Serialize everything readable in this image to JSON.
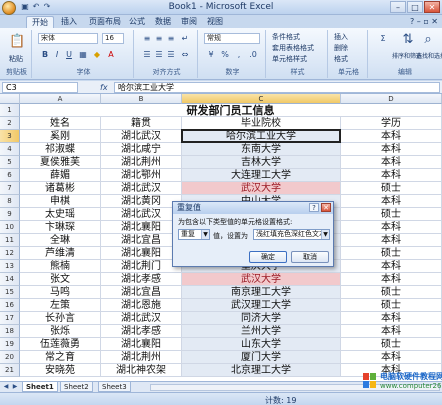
{
  "window": {
    "title": "Book1 - Microsoft Excel"
  },
  "tabs": [
    "开始",
    "插入",
    "页面布局",
    "公式",
    "数据",
    "审阅",
    "视图"
  ],
  "ribbon": {
    "clipboard": {
      "paste": "粘贴",
      "label": "剪贴板"
    },
    "font": {
      "name": "宋体",
      "size": "16",
      "label": "字体"
    },
    "alignment": {
      "label": "对齐方式"
    },
    "number": {
      "format": "常规",
      "label": "数字"
    },
    "styles": {
      "conditional": "条件格式",
      "table": "套用表格格式",
      "cell": "单元格样式",
      "label": "样式"
    },
    "cells": {
      "insert": "插入",
      "delete": "删除",
      "format": "格式",
      "label": "单元格"
    },
    "editing": {
      "sort": "排序和筛选",
      "find": "查找和选择",
      "label": "编辑"
    }
  },
  "formula_bar": {
    "name_box": "C3",
    "fx": "fx",
    "content": "哈尔滨工业大学"
  },
  "columns": [
    "A",
    "B",
    "C",
    "D"
  ],
  "rows": [
    {
      "num": "1",
      "cells": [
        "",
        "研发部门员工信息",
        "",
        ""
      ]
    },
    {
      "num": "2",
      "cells": [
        "姓名",
        "籍贯",
        "毕业院校",
        "学历"
      ]
    },
    {
      "num": "3",
      "cells": [
        "奚刚",
        "湖北武汉",
        "哈尔滨工业大学",
        "本科"
      ]
    },
    {
      "num": "4",
      "cells": [
        "祁淑蝶",
        "湖北咸宁",
        "东南大学",
        "本科"
      ]
    },
    {
      "num": "5",
      "cells": [
        "夏侯雅芙",
        "湖北荆州",
        "吉林大学",
        "本科"
      ]
    },
    {
      "num": "6",
      "cells": [
        "薛媚",
        "湖北鄂州",
        "大连理工大学",
        "本科"
      ]
    },
    {
      "num": "7",
      "cells": [
        "诸葛彬",
        "湖北武汉",
        "武汉大学",
        "硕士"
      ]
    },
    {
      "num": "8",
      "cells": [
        "申棋",
        "湖北黄冈",
        "中山大学",
        "本科"
      ]
    },
    {
      "num": "9",
      "cells": [
        "太史瑶",
        "湖北武汉",
        "",
        "硕士"
      ]
    },
    {
      "num": "10",
      "cells": [
        "卞琳琛",
        "湖北襄阳",
        "",
        "本科"
      ]
    },
    {
      "num": "11",
      "cells": [
        "全琳",
        "湖北宜昌",
        "",
        "本科"
      ]
    },
    {
      "num": "12",
      "cells": [
        "芦维清",
        "湖北襄阳",
        "",
        "硕士"
      ]
    },
    {
      "num": "13",
      "cells": [
        "熊楠",
        "湖北荆门",
        "重庆大学",
        "本科"
      ]
    },
    {
      "num": "14",
      "cells": [
        "张文",
        "湖北孝感",
        "武汉大学",
        "本科"
      ]
    },
    {
      "num": "15",
      "cells": [
        "马鸣",
        "湖北宜昌",
        "南京理工大学",
        "硕士"
      ]
    },
    {
      "num": "16",
      "cells": [
        "左策",
        "湖北恩施",
        "武汉理工大学",
        "硕士"
      ]
    },
    {
      "num": "17",
      "cells": [
        "长孙言",
        "湖北武汉",
        "同济大学",
        "本科"
      ]
    },
    {
      "num": "18",
      "cells": [
        "张烁",
        "湖北孝感",
        "兰州大学",
        "本科"
      ]
    },
    {
      "num": "19",
      "cells": [
        "伍莲薇勇",
        "湖北襄阳",
        "山东大学",
        "硕士"
      ]
    },
    {
      "num": "20",
      "cells": [
        "常之育",
        "湖北荆州",
        "厦门大学",
        "本科"
      ]
    },
    {
      "num": "21",
      "cells": [
        "安晓苑",
        "湖北神农架",
        "北京理工大学",
        "本科"
      ]
    }
  ],
  "red_rows": [
    "7",
    "14"
  ],
  "dialog": {
    "title": "重复值",
    "prompt": "为包含以下类型值的单元格设置格式:",
    "type_value": "重复",
    "middle_text": "值，设置为",
    "format_value": "浅红填充色深红色文本",
    "ok": "确定",
    "cancel": "取消"
  },
  "sheets": [
    "Sheet1",
    "Sheet2",
    "Sheet3"
  ],
  "status": {
    "count": "计数: 19"
  },
  "watermark": {
    "line1": "电脑软硬件教程网",
    "line2": "www.computer26.com"
  },
  "colors": {
    "accent": "#1e3a66",
    "dup_fill": "#f2c9cc",
    "dup_text": "#9a1a24"
  }
}
